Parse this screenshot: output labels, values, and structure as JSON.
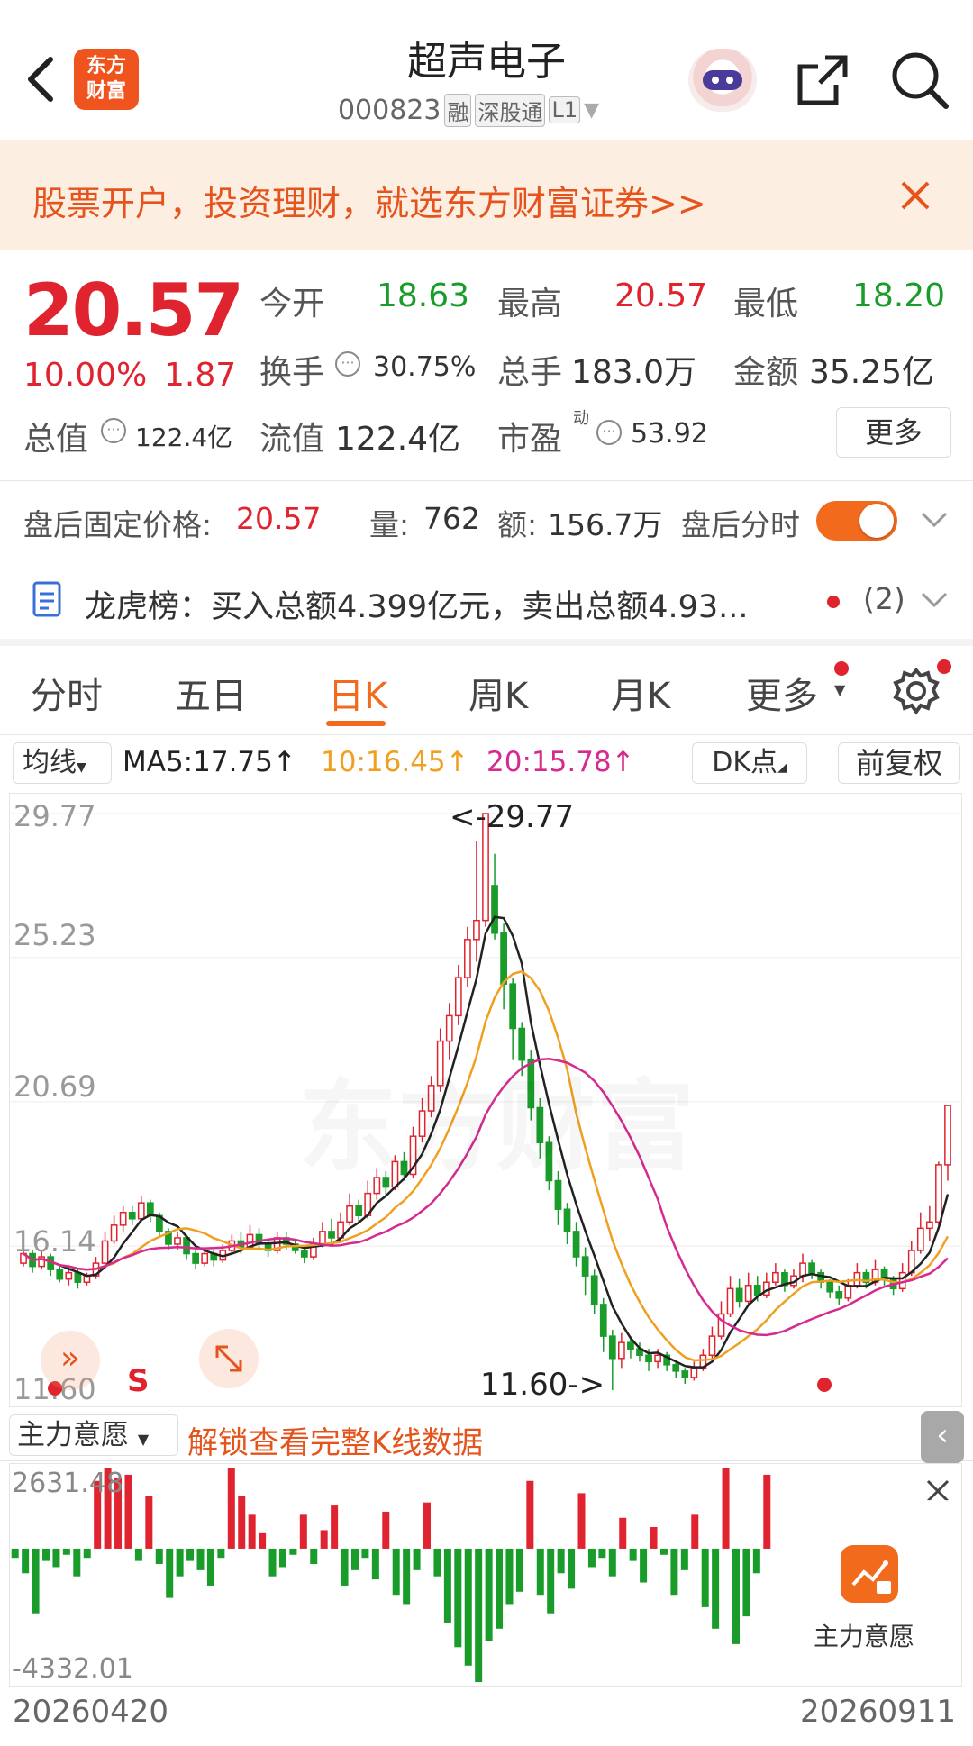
{
  "header": {
    "title": "超声电子",
    "code": "000823",
    "badge_margin": "融",
    "badge_connect": "深股通",
    "badge_level": "L1",
    "logo_text": "东方\n财富"
  },
  "banner": {
    "text": "股票开户，投资理财，就选东方财富证券>>"
  },
  "quote": {
    "price": "20.57",
    "change_pct": "10.00%",
    "change_abs": "1.87",
    "open_label": "今开",
    "open": "18.63",
    "high_label": "最高",
    "high": "20.57",
    "low_label": "最低",
    "low": "18.20",
    "turnover_label": "换手",
    "turnover": "30.75%",
    "volume_label": "总手",
    "volume": "183.0万",
    "amount_label": "金额",
    "amount": "35.25亿",
    "mktcap_label": "总值",
    "mktcap": "122.4亿",
    "float_label": "流值",
    "float": "122.4亿",
    "pe_label": "市盈",
    "pe_sup": "动",
    "pe": "53.92",
    "more_button": "更多"
  },
  "after_hours": {
    "price_label": "盘后固定价格:",
    "price": "20.57",
    "vol_label": "量:",
    "vol": "762",
    "amt_label": "额:",
    "amt": "156.7万",
    "timeshare_label": "盘后分时",
    "toggle_on": true
  },
  "dragon_tiger": {
    "text": "龙虎榜：买入总额4.399亿元，卖出总额4.93...",
    "count": "(2)"
  },
  "tabs": [
    "分时",
    "五日",
    "日K",
    "周K",
    "月K",
    "更多"
  ],
  "active_tab": "日K",
  "ma_bar": {
    "selector": "均线",
    "ma5": "MA5:17.75↑",
    "ma10": "10:16.45↑",
    "ma20": "20:15.78↑",
    "dk_button": "DK点",
    "adjust_button": "前复权"
  },
  "kline": {
    "y_labels": [
      "29.77",
      "25.23",
      "20.69",
      "16.14",
      "11.60"
    ],
    "max_marker": "<-29.77",
    "min_marker": "11.60->",
    "s_marker": "S"
  },
  "main_force": {
    "selector": "主力意愿",
    "unlock_text": "解锁查看完整K线数据",
    "y_top": "2631.48",
    "y_bottom": "-4332.01",
    "side_label": "主力意愿"
  },
  "dates": {
    "start": "20260420",
    "end": "20260911"
  },
  "colors": {
    "up": "#e0242f",
    "down": "#1a9c2b",
    "accent": "#f26b1d",
    "ma5": "#222222",
    "ma10": "#f0a020",
    "ma20": "#d62a8f"
  },
  "chart_data": {
    "type": "candlestick",
    "y_range": [
      11.6,
      29.77
    ],
    "x_range": [
      "20260420",
      "20260911"
    ],
    "candles": [
      [
        15.6,
        15.9,
        15.5,
        16.2
      ],
      [
        15.9,
        15.5,
        15.3,
        16.0
      ],
      [
        15.5,
        15.8,
        15.4,
        16.0
      ],
      [
        15.8,
        15.4,
        15.2,
        15.9
      ],
      [
        15.4,
        15.1,
        15.0,
        15.5
      ],
      [
        15.1,
        15.3,
        14.9,
        15.5
      ],
      [
        15.3,
        15.0,
        14.8,
        15.4
      ],
      [
        15.0,
        15.2,
        14.9,
        15.3
      ],
      [
        15.2,
        15.6,
        15.1,
        15.8
      ],
      [
        15.6,
        16.3,
        15.5,
        16.6
      ],
      [
        16.3,
        16.8,
        16.2,
        17.1
      ],
      [
        16.8,
        17.2,
        16.6,
        17.4
      ],
      [
        17.2,
        17.0,
        16.8,
        17.4
      ],
      [
        17.0,
        17.5,
        16.9,
        17.7
      ],
      [
        17.5,
        17.1,
        16.9,
        17.6
      ],
      [
        17.1,
        16.6,
        16.4,
        17.2
      ],
      [
        16.6,
        16.2,
        16.0,
        16.7
      ],
      [
        16.2,
        16.4,
        16.0,
        16.6
      ],
      [
        16.4,
        15.9,
        15.7,
        16.5
      ],
      [
        15.9,
        15.6,
        15.4,
        16.0
      ],
      [
        15.6,
        15.9,
        15.5,
        16.1
      ],
      [
        15.9,
        15.7,
        15.5,
        16.0
      ],
      [
        15.7,
        16.0,
        15.6,
        16.2
      ],
      [
        16.0,
        16.3,
        15.9,
        16.5
      ],
      [
        16.3,
        16.1,
        15.9,
        16.6
      ],
      [
        16.1,
        16.5,
        16.0,
        16.8
      ],
      [
        16.5,
        16.2,
        16.0,
        16.7
      ],
      [
        16.2,
        16.0,
        15.8,
        16.3
      ],
      [
        16.0,
        16.4,
        15.9,
        16.6
      ],
      [
        16.4,
        16.2,
        16.0,
        16.6
      ],
      [
        16.2,
        16.0,
        15.9,
        16.3
      ],
      [
        16.0,
        15.8,
        15.6,
        16.1
      ],
      [
        15.8,
        16.2,
        15.7,
        16.4
      ],
      [
        16.2,
        16.6,
        16.1,
        16.9
      ],
      [
        16.6,
        16.4,
        16.2,
        17.0
      ],
      [
        16.4,
        16.9,
        16.3,
        17.2
      ],
      [
        16.9,
        17.4,
        16.8,
        17.8
      ],
      [
        17.4,
        17.1,
        16.9,
        17.6
      ],
      [
        17.1,
        17.8,
        17.0,
        18.2
      ],
      [
        17.8,
        18.3,
        17.6,
        18.6
      ],
      [
        18.3,
        18.0,
        17.7,
        18.5
      ],
      [
        18.0,
        18.8,
        17.9,
        19.0
      ],
      [
        18.8,
        18.4,
        18.2,
        19.1
      ],
      [
        18.4,
        19.6,
        18.3,
        19.9
      ],
      [
        19.6,
        20.4,
        19.4,
        20.8
      ],
      [
        20.4,
        21.2,
        20.2,
        21.5
      ],
      [
        21.2,
        22.6,
        21.0,
        23.0
      ],
      [
        22.6,
        23.4,
        22.0,
        23.8
      ],
      [
        23.4,
        24.6,
        23.1,
        25.0
      ],
      [
        24.6,
        25.8,
        24.3,
        26.2
      ],
      [
        25.8,
        26.4,
        25.1,
        28.9
      ],
      [
        26.4,
        29.77,
        26.2,
        29.77
      ],
      [
        27.5,
        26.0,
        25.8,
        28.5
      ],
      [
        26.0,
        24.4,
        23.6,
        26.3
      ],
      [
        24.4,
        23.0,
        22.0,
        24.6
      ],
      [
        23.0,
        22.0,
        21.5,
        23.2
      ],
      [
        22.0,
        20.5,
        20.1,
        22.3
      ],
      [
        20.5,
        19.4,
        18.9,
        20.8
      ],
      [
        19.4,
        18.2,
        17.9,
        19.6
      ],
      [
        18.2,
        17.3,
        16.8,
        18.5
      ],
      [
        17.3,
        16.6,
        16.2,
        17.5
      ],
      [
        16.6,
        15.8,
        15.5,
        16.9
      ],
      [
        15.8,
        15.2,
        14.6,
        16.1
      ],
      [
        15.2,
        14.3,
        14.0,
        15.4
      ],
      [
        14.3,
        13.3,
        12.8,
        14.5
      ],
      [
        13.3,
        12.6,
        11.6,
        13.5
      ],
      [
        12.6,
        13.1,
        12.3,
        13.4
      ],
      [
        13.1,
        12.9,
        12.6,
        13.3
      ],
      [
        12.9,
        12.7,
        12.5,
        13.1
      ],
      [
        12.7,
        12.5,
        12.2,
        12.9
      ],
      [
        12.5,
        12.7,
        12.3,
        12.9
      ],
      [
        12.7,
        12.4,
        12.2,
        12.8
      ],
      [
        12.4,
        12.2,
        12.0,
        12.5
      ],
      [
        12.2,
        12.0,
        11.8,
        12.3
      ],
      [
        12.0,
        12.3,
        11.9,
        12.5
      ],
      [
        12.3,
        12.7,
        12.2,
        12.9
      ],
      [
        12.7,
        13.3,
        12.6,
        13.6
      ],
      [
        13.3,
        14.0,
        13.2,
        14.4
      ],
      [
        14.0,
        14.8,
        13.9,
        15.2
      ],
      [
        14.8,
        14.4,
        14.2,
        15.1
      ],
      [
        14.4,
        14.9,
        14.3,
        15.3
      ],
      [
        14.9,
        14.6,
        14.4,
        15.2
      ],
      [
        14.6,
        15.0,
        14.5,
        15.3
      ],
      [
        15.0,
        15.3,
        14.9,
        15.6
      ],
      [
        15.3,
        14.9,
        14.7,
        15.4
      ],
      [
        14.9,
        15.2,
        14.8,
        15.4
      ],
      [
        15.2,
        15.6,
        15.0,
        15.9
      ],
      [
        15.6,
        15.3,
        15.1,
        15.7
      ],
      [
        15.3,
        15.0,
        14.8,
        15.4
      ],
      [
        15.0,
        14.7,
        14.5,
        15.1
      ],
      [
        14.7,
        14.5,
        14.3,
        14.9
      ],
      [
        14.5,
        14.9,
        14.4,
        15.1
      ],
      [
        14.9,
        15.3,
        14.8,
        15.6
      ],
      [
        15.3,
        15.0,
        14.8,
        15.4
      ],
      [
        15.0,
        15.4,
        14.9,
        15.7
      ],
      [
        15.4,
        15.1,
        14.9,
        15.5
      ],
      [
        15.1,
        14.8,
        14.6,
        15.2
      ],
      [
        14.8,
        15.3,
        14.7,
        15.6
      ],
      [
        15.3,
        16.0,
        15.2,
        16.3
      ],
      [
        16.0,
        16.7,
        15.9,
        17.2
      ],
      [
        16.7,
        16.9,
        16.3,
        17.4
      ],
      [
        16.9,
        18.7,
        16.8,
        18.8
      ],
      [
        18.7,
        20.57,
        18.2,
        20.57
      ]
    ],
    "main_force_range": [
      -4332.01,
      2631.48
    ],
    "main_force_values": [
      -300,
      -800,
      -2100,
      -400,
      -600,
      -200,
      -900,
      -300,
      2200,
      2631.48,
      2300,
      2400,
      -400,
      1700,
      -500,
      -1600,
      -900,
      -400,
      -700,
      -1200,
      -300,
      2631.48,
      1700,
      1100,
      500,
      -900,
      -600,
      -200,
      1100,
      -500,
      600,
      1400,
      -1200,
      -700,
      -300,
      -1000,
      1200,
      -1500,
      -1800,
      -700,
      1500,
      -900,
      -2400,
      -3200,
      -3800,
      -4332.01,
      -3000,
      -2600,
      -1800,
      -1400,
      2200,
      -1500,
      -2100,
      -800,
      -1300,
      1800,
      -600,
      -300,
      -900,
      1000,
      -400,
      -1100,
      700,
      -200,
      -1500,
      -700,
      1100,
      -1900,
      -2600,
      2631.48,
      -3100,
      -2200,
      -800,
      2400
    ]
  }
}
